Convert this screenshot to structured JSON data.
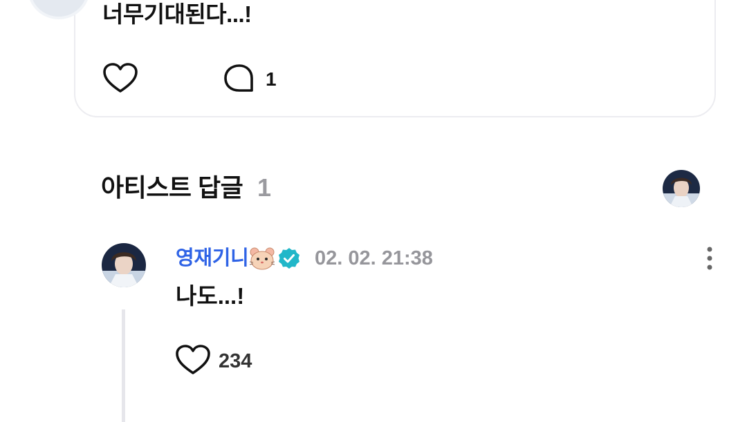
{
  "post": {
    "text": "너무기대된다...!",
    "comment_count": "1"
  },
  "artist_replies": {
    "title": "아티스트 답글",
    "count": "1"
  },
  "reply": {
    "author": "영재기니",
    "timestamp": "02. 02. 21:38",
    "text": "나도...!",
    "like_count": "234"
  },
  "icons": {
    "like": "heart-outline-icon",
    "comment": "speech-bubble-icon",
    "badge": "verified-check-icon",
    "emoji": "hamster-face-icon",
    "menu": "vertical-ellipsis-icon"
  },
  "colors": {
    "author_name": "#2f63e6",
    "verified_badge": "#21b7c9",
    "muted_text": "#96969b",
    "card_border": "#ececf0"
  }
}
